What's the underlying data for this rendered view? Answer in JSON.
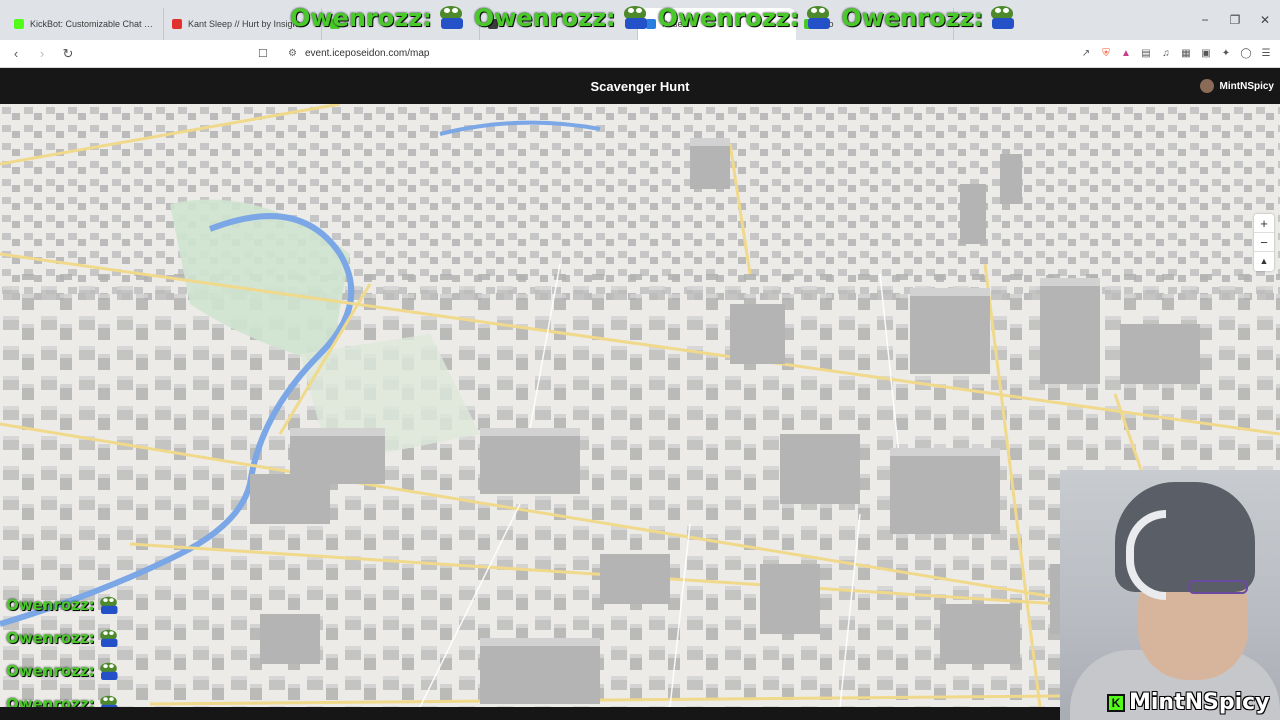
{
  "browser": {
    "tabs": [
      {
        "label": "KickBot: Customizable Chat Bot for K",
        "fav_color": "#53fc18",
        "active": false
      },
      {
        "label": "Kant Sleep // Hurt by Insight",
        "fav_color": "#e0312e",
        "active": false
      },
      {
        "label": "",
        "fav_color": "#4ac92a",
        "active": false
      },
      {
        "label": "",
        "fav_color": "#3b3b3b",
        "active": false
      },
      {
        "label": "Poseid",
        "fav_color": "#2a7de1",
        "active": true
      },
      {
        "label": "Sto",
        "fav_color": "#4ac92a",
        "active": false
      }
    ],
    "window_controls": [
      "−",
      "❐",
      "✕"
    ],
    "url": "event.iceposeidon.com/map"
  },
  "site": {
    "title": "Scavenger Hunt",
    "username": "MintNSpicy"
  },
  "map": {
    "zoom_in": "+",
    "zoom_out": "−",
    "compass": "▲"
  },
  "overlay": {
    "banner_name": "Owenrozz:",
    "chat_name": "Owenrozz:",
    "cam_name": "MintNSpicy",
    "kick_letter": "K"
  }
}
